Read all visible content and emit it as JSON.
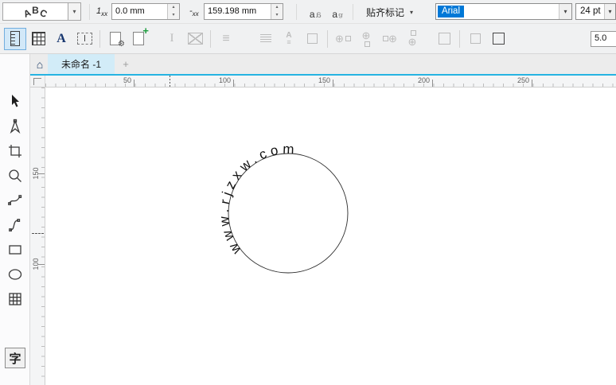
{
  "property_bar": {
    "abc": {
      "l1": "A",
      "l2": "B",
      "l3": "C"
    },
    "dropdown_arrow": "▾",
    "distance": {
      "icon_main": "1",
      "icon_sub": "xx",
      "value": "0.0 mm"
    },
    "offset": {
      "icon_main": "-",
      "icon_sub": "xx",
      "value": "159.198 mm"
    },
    "mirror_letter": "a",
    "snap_label": "贴齐标记",
    "font_name": "Arial",
    "font_size": "24 pt",
    "spin_up": "▴",
    "spin_down": "▾"
  },
  "toolbar2": {
    "format_a": "A",
    "gear": "⚙",
    "plus": "+",
    "ibeam": "I",
    "lines": "≡",
    "crosshair": "⊕",
    "stroke_width": "5.0"
  },
  "tabs": {
    "home_icon": "⌂",
    "title": "未命名 -1",
    "add": "+"
  },
  "rulers": {
    "h": [
      "50",
      "100",
      "150",
      "200",
      "250"
    ],
    "v": [
      "150",
      "100"
    ]
  },
  "toolbox": {
    "text_glyph": "字"
  },
  "canvas": {
    "curved_text": "www.rjzxw.com"
  }
}
